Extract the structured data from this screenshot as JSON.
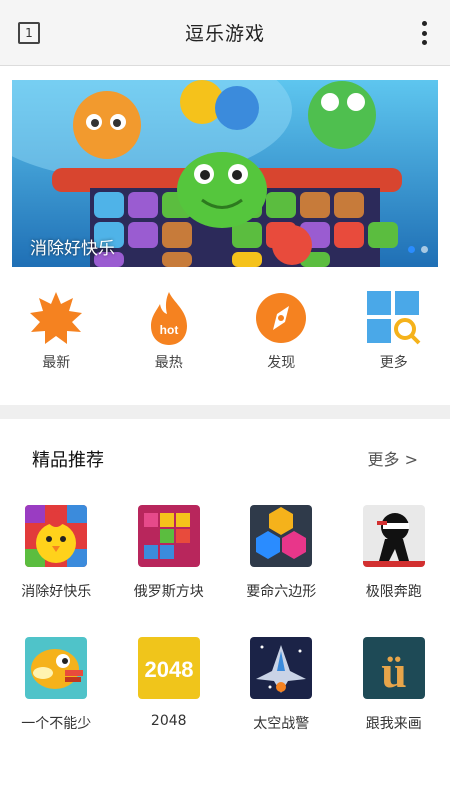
{
  "header": {
    "title": "逗乐游戏",
    "tab_count": "1"
  },
  "banner": {
    "caption": "消除好快乐",
    "slide_count": 2,
    "active_slide": 1
  },
  "quick_nav": [
    {
      "label": "最新",
      "icon": "sun-burst-icon"
    },
    {
      "label": "最热",
      "icon": "hot-flame-icon",
      "badge": "hot"
    },
    {
      "label": "发现",
      "icon": "compass-icon"
    },
    {
      "label": "更多",
      "icon": "grid-search-icon"
    }
  ],
  "section": {
    "title": "精品推荐",
    "more": "更多 >"
  },
  "games": [
    {
      "name": "消除好快乐",
      "icon": "match-pets-game-icon"
    },
    {
      "name": "俄罗斯方块",
      "icon": "tetris-blocks-icon"
    },
    {
      "name": "要命六边形",
      "icon": "hexagon-game-icon"
    },
    {
      "name": "极限奔跑",
      "icon": "ninja-runner-icon"
    },
    {
      "name": "一个不能少",
      "icon": "flappy-bird-icon"
    },
    {
      "name": "2048",
      "icon": "2048-tile-icon",
      "tile_text": "2048"
    },
    {
      "name": "太空战警",
      "icon": "spaceship-icon"
    },
    {
      "name": "跟我来画",
      "icon": "draw-letter-icon",
      "tile_text": "ü"
    }
  ],
  "colors": {
    "accent_orange": "#f58220",
    "dot_active": "#2a8cff",
    "header_bg": "#f5f5f5"
  }
}
